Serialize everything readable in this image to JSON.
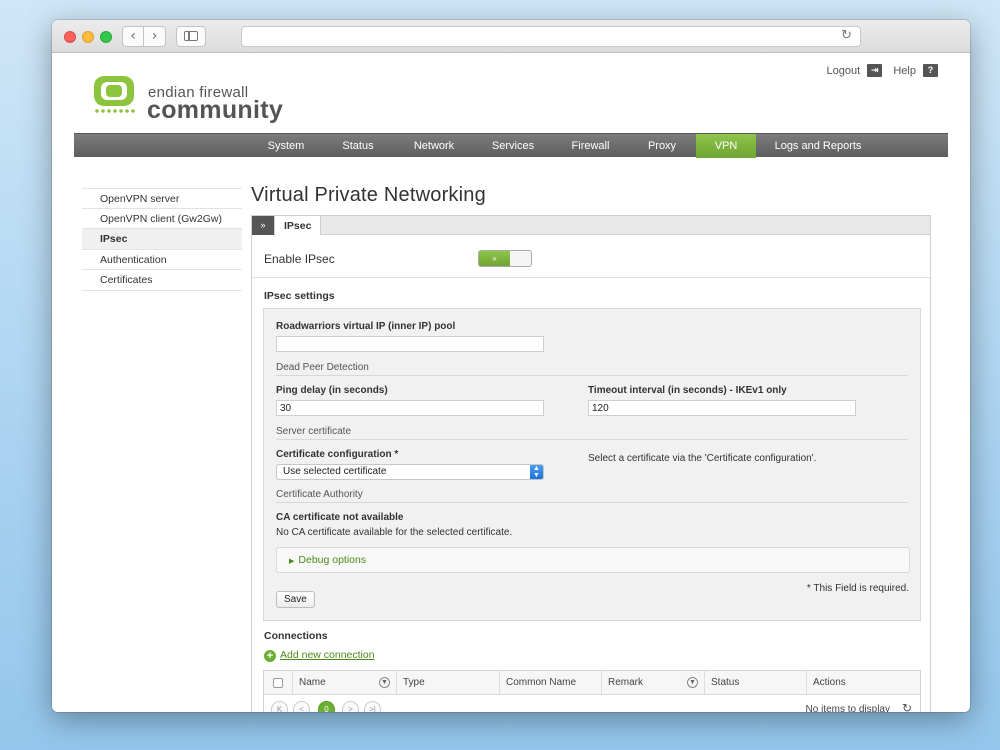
{
  "toplinks": {
    "logout": "Logout",
    "help": "Help"
  },
  "logo": {
    "line1": "endian firewall",
    "line2": "community"
  },
  "mainnav": [
    "System",
    "Status",
    "Network",
    "Services",
    "Firewall",
    "Proxy",
    "VPN",
    "Logs and Reports"
  ],
  "mainnav_active": "VPN",
  "sidenav": [
    "OpenVPN server",
    "OpenVPN client (Gw2Gw)",
    "IPsec",
    "Authentication",
    "Certificates"
  ],
  "sidenav_active": "IPsec",
  "page_title": "Virtual Private Networking",
  "tab": {
    "icon": "»",
    "label": "IPsec"
  },
  "enable": {
    "label": "Enable IPsec",
    "toggle_glyph": "»",
    "state": "on"
  },
  "settings": {
    "title": "IPsec settings",
    "pool_label": "Roadwarriors virtual IP (inner IP) pool",
    "pool_value": "",
    "dpd_title": "Dead Peer Detection",
    "ping_label": "Ping delay (in seconds)",
    "ping_value": "30",
    "timeout_label": "Timeout interval (in seconds) - IKEv1 only",
    "timeout_value": "120",
    "server_cert_title": "Server certificate",
    "cert_config_label": "Certificate configuration *",
    "cert_config_value": "Use selected certificate",
    "cert_hint": "Select a certificate via the 'Certificate configuration'.",
    "ca_title": "Certificate Authority",
    "ca_na_title": "CA certificate not available",
    "ca_na_text": "No CA certificate available for the selected certificate.",
    "debug_label": "Debug options",
    "required_note": "* This Field is required.",
    "save_label": "Save"
  },
  "connections": {
    "title": "Connections",
    "add_label": "Add new connection",
    "columns": [
      "Name",
      "Type",
      "Common Name",
      "Remark",
      "Status",
      "Actions"
    ],
    "pager": {
      "first": "K",
      "prev": "<",
      "current": "0",
      "next": ">",
      "last": ">|"
    },
    "empty_text": "No items to display"
  },
  "colors": {
    "accent_green": "#6ea431",
    "nav_gray": "#5e5e5e"
  }
}
